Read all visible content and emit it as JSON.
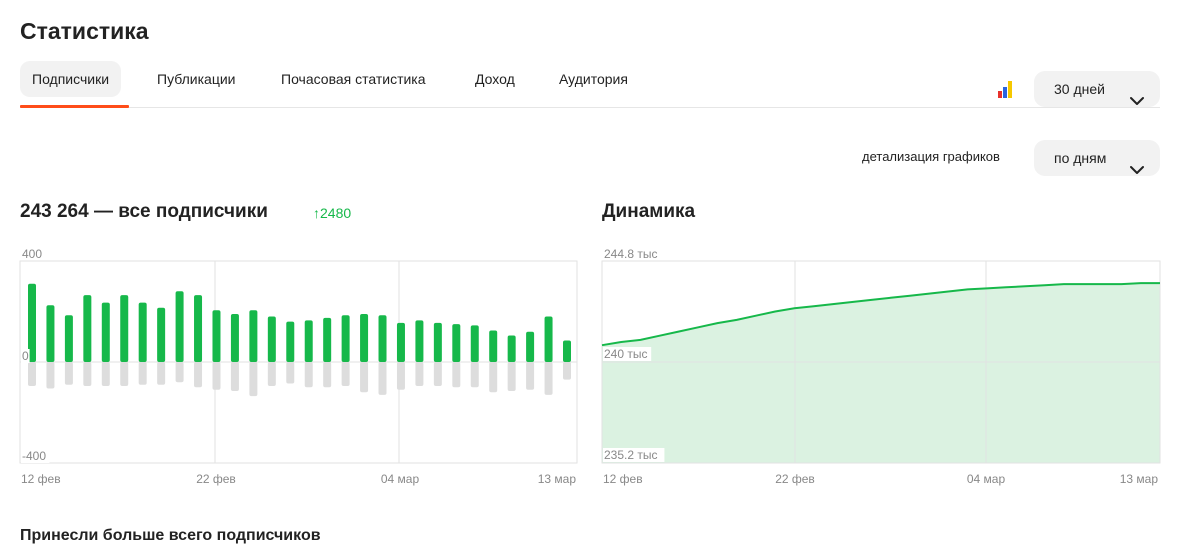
{
  "page": {
    "title": "Статистика"
  },
  "tabs": [
    {
      "label": "Подписчики",
      "active": true
    },
    {
      "label": "Публикации"
    },
    {
      "label": "Почасовая статистика"
    },
    {
      "label": "Доход"
    },
    {
      "label": "Аудитория"
    }
  ],
  "toolbar": {
    "stats_icon": "bar-chart-icon",
    "period": "30 дней",
    "detail_label": "детализация графиков",
    "detail_value": "по дням"
  },
  "colors": {
    "accent": "#ff4d19",
    "green": "#16b84a",
    "negative": "#dddddd",
    "area": "#dbf2e1"
  },
  "subscribers": {
    "heading": "243 264 — все подписчики",
    "delta": "2480"
  },
  "dynamics": {
    "heading": "Динамика"
  },
  "bottom": {
    "heading": "Принесли больше всего подписчиков"
  },
  "chart_data": [
    {
      "type": "bar",
      "ylim": [
        -400,
        400
      ],
      "y_ticks": [
        "400",
        "0",
        "-400"
      ],
      "x_tick_labels": [
        "12 фев",
        "22 фев",
        "04 мар",
        "13 мар"
      ],
      "grid": true,
      "series": [
        {
          "values": [
            310,
            225,
            185,
            265,
            235,
            265,
            235,
            215,
            280,
            265,
            205,
            190,
            205,
            180,
            160,
            165,
            175,
            185,
            190,
            185,
            155,
            165,
            155,
            150,
            145,
            125,
            105,
            120,
            180,
            85
          ]
        },
        {
          "values": [
            -95,
            -105,
            -90,
            -95,
            -95,
            -95,
            -90,
            -90,
            -80,
            -100,
            -110,
            -115,
            -135,
            -95,
            -85,
            -100,
            -100,
            -95,
            -120,
            -130,
            -110,
            -95,
            -95,
            -100,
            -100,
            -120,
            -115,
            -110,
            -130,
            -70
          ]
        }
      ]
    },
    {
      "type": "area",
      "ylim": [
        235.2,
        244.8
      ],
      "y_ticks": [
        "244.8 тыс",
        "240 тыс",
        "235.2 тыс"
      ],
      "x_tick_labels": [
        "12 фев",
        "22 фев",
        "04 мар",
        "13 мар"
      ],
      "grid": true,
      "series": [
        {
          "values": [
            240.8,
            240.95,
            241.05,
            241.25,
            241.45,
            241.65,
            241.85,
            242.0,
            242.2,
            242.4,
            242.55,
            242.65,
            242.75,
            242.85,
            242.95,
            243.05,
            243.15,
            243.25,
            243.35,
            243.45,
            243.5,
            243.55,
            243.6,
            243.65,
            243.7,
            243.7,
            243.7,
            243.7,
            243.75,
            243.75
          ]
        }
      ]
    }
  ]
}
